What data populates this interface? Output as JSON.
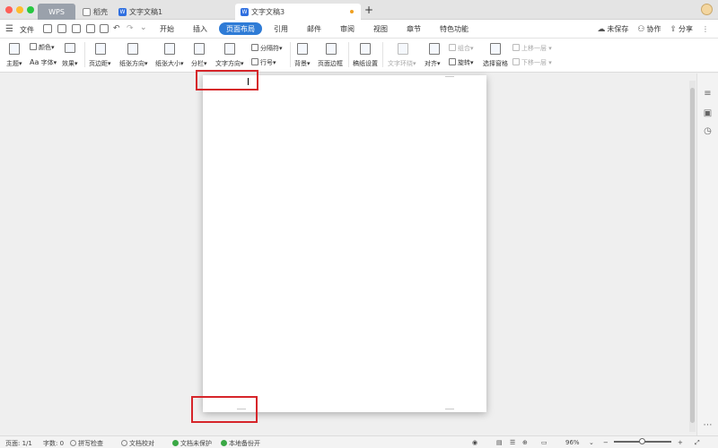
{
  "tabs": {
    "wps": "WPS",
    "daoke": "稻壳",
    "doc1": "文字文稿1",
    "doc3": "文字文稿3",
    "new_tab": "+"
  },
  "menubar": {
    "file": "文件",
    "items": [
      "开始",
      "插入",
      "页面布局",
      "引用",
      "邮件",
      "审阅",
      "视图",
      "章节",
      "特色功能"
    ],
    "active_index": 2,
    "unsaved": "未保存",
    "collaborate": "协作",
    "share": "分享"
  },
  "ribbon": {
    "theme": "主题",
    "color": "颜色",
    "font": "字体",
    "effect": "效果",
    "margins": "页边距",
    "orientation": "纸张方向",
    "size": "纸张大小",
    "columns": "分栏",
    "text_direction": "文字方向",
    "breaks": "分隔符",
    "line_numbers": "行号",
    "background": "背景",
    "page_border": "页面边框",
    "manuscript": "稿纸设置",
    "wrap_text": "文字环绕",
    "align": "对齐",
    "rotate": "旋转",
    "group": "组合",
    "selection_pane": "选择窗格",
    "bring_forward": "上移一层",
    "send_backward": "下移一层"
  },
  "status": {
    "page": "页面: 1/1",
    "words": "字数: 0",
    "spell": "拼写检查",
    "proof": "文档校对",
    "protect": "文档未保护",
    "backup": "本地备份开",
    "zoom": "96%"
  },
  "colors": {
    "accent": "#2e7bd6",
    "highlight_box": "#d6252a"
  }
}
